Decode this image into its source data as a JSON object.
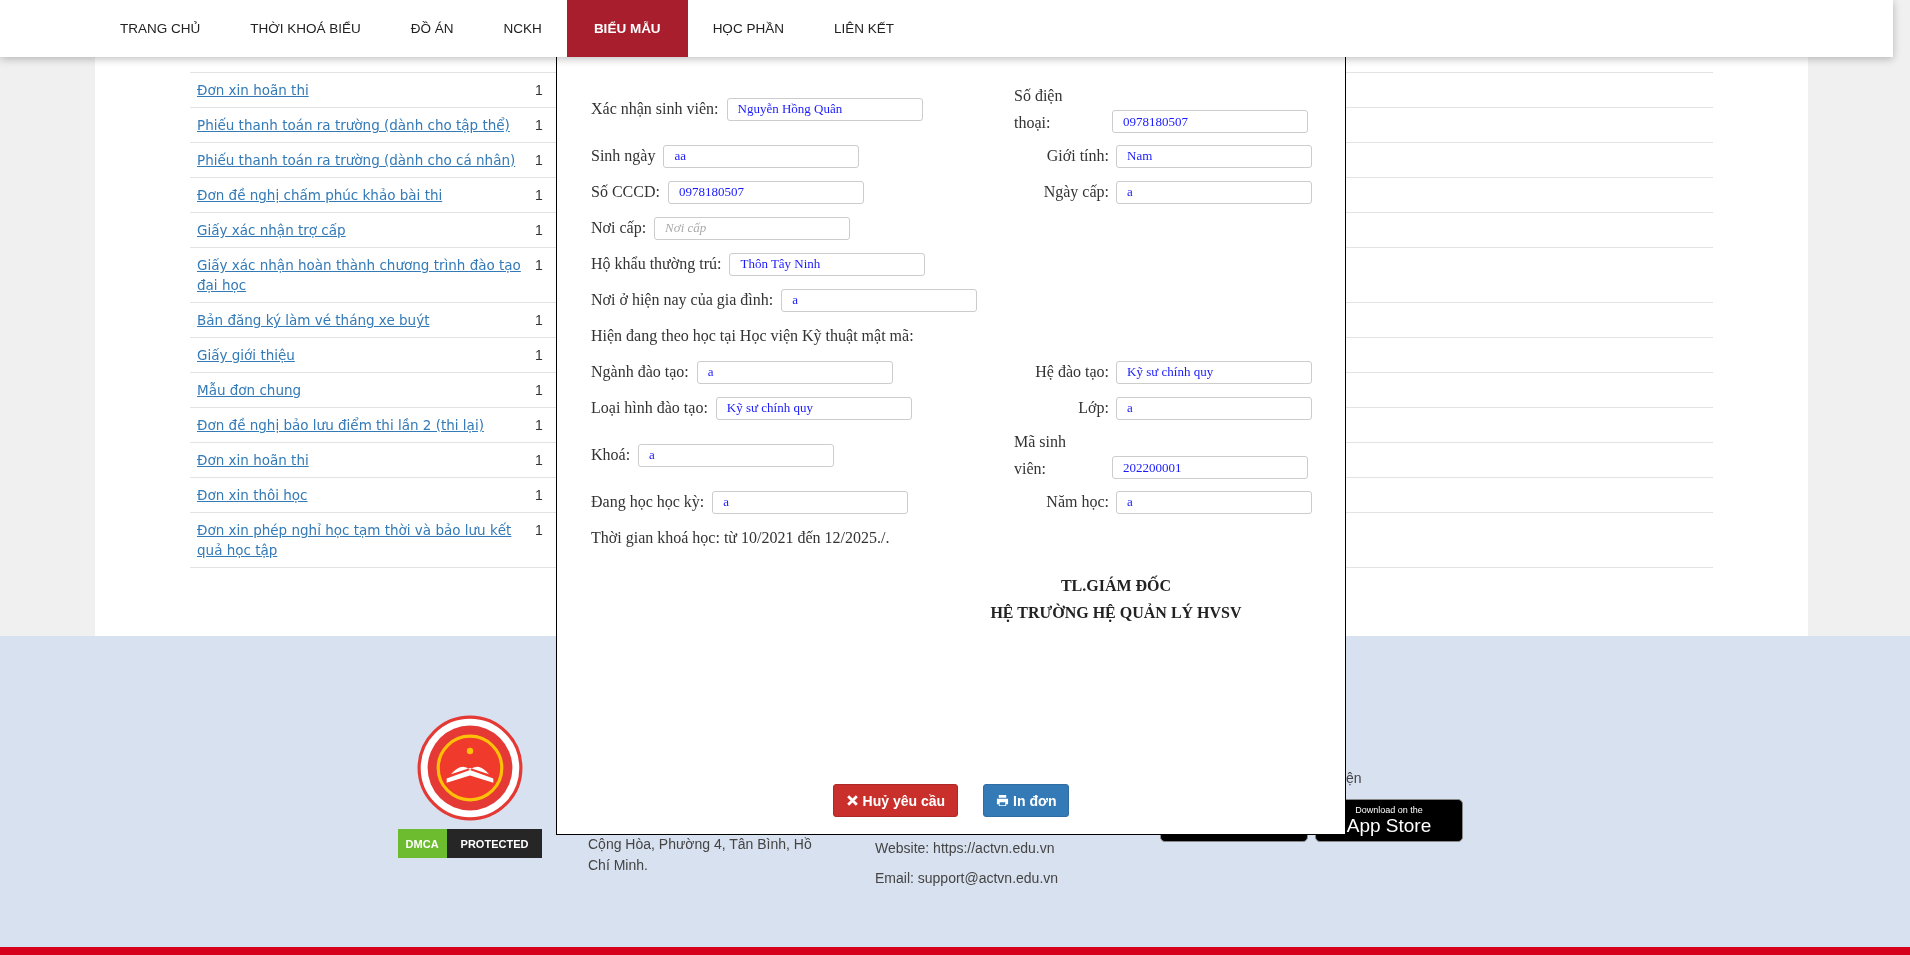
{
  "nav": {
    "items": [
      {
        "label": "TRANG CHỦ",
        "selected": false
      },
      {
        "label": "THỜI KHOÁ BIỂU",
        "selected": false
      },
      {
        "label": "ĐỒ ÁN",
        "selected": false
      },
      {
        "label": "NCKH",
        "selected": false
      },
      {
        "label": "BIỂU MẪU",
        "selected": true
      },
      {
        "label": "HỌC PHẦN",
        "selected": false
      },
      {
        "label": "LIÊN KẾT",
        "selected": false
      }
    ]
  },
  "forms_table": {
    "rows": [
      {
        "name": "Đơn xin hoãn thi",
        "count": "1"
      },
      {
        "name": "Phiếu thanh toán ra trường (dành cho tập thể)",
        "count": "1"
      },
      {
        "name": "Phiếu thanh toán ra trường (dành cho cá nhân)",
        "count": "1"
      },
      {
        "name": "Đơn đề nghị chấm phúc khảo bài thi",
        "count": "1"
      },
      {
        "name": "Giấy xác nhận trợ cấp",
        "count": "1"
      },
      {
        "name": "Giấy xác nhận hoàn thành chương trình đào tạo đại học",
        "count": "1"
      },
      {
        "name": "Bản đăng ký làm vé tháng xe buýt",
        "count": "1"
      },
      {
        "name": "Giấy giới thiệu",
        "count": "1"
      },
      {
        "name": "Mẫu đơn chung",
        "count": "1"
      },
      {
        "name": "Đơn đề nghị bảo lưu điểm thi lần 2 (thi lại)",
        "count": "1"
      },
      {
        "name": "Đơn xin hoãn thi",
        "count": "1"
      },
      {
        "name": "Đơn xin thôi học",
        "count": "1"
      },
      {
        "name": "Đơn xin phép nghỉ học tạm thời và bảo lưu kết quả học tập",
        "count": "1"
      }
    ]
  },
  "dialog": {
    "rows": [
      {
        "kind": "pair",
        "left": {
          "label": "Xác nhận sinh viên:",
          "value": "Nguyễn Hồng Quân"
        },
        "right": {
          "label": "Số điện thoại:",
          "value": "0978180507",
          "kind": "stacked"
        }
      },
      {
        "kind": "pair",
        "left": {
          "label": "Sinh ngày",
          "value": "aa"
        },
        "right": {
          "label": "Giới tính:",
          "value": "Nam",
          "kind": "inline"
        }
      },
      {
        "kind": "pair",
        "left": {
          "label": "Số CCCD:",
          "value": "0978180507"
        },
        "right": {
          "label": "Ngày cấp:",
          "value": "a",
          "kind": "inline"
        }
      },
      {
        "kind": "pair",
        "left": {
          "label": "Nơi cấp:",
          "placeholder": "Nơi cấp"
        }
      },
      {
        "kind": "pair",
        "left": {
          "label": "Hộ khẩu thường trú:",
          "value": "Thôn Tây Ninh"
        }
      },
      {
        "kind": "pair",
        "left": {
          "label": "Nơi ở hiện nay của gia đình:",
          "value": "a"
        }
      },
      {
        "kind": "note",
        "text": "Hiện đang theo học tại Học viện Kỹ thuật mật mã:"
      },
      {
        "kind": "pair",
        "left": {
          "label": "Ngành đào tạo:",
          "value": "a"
        },
        "right": {
          "label": "Hệ đào tạo:",
          "value": "Kỹ sư chính quy",
          "kind": "inline"
        }
      },
      {
        "kind": "pair",
        "left": {
          "label": "Loại hình đào tạo:",
          "value": "Kỹ sư chính quy"
        },
        "right": {
          "label": "Lớp:",
          "value": "a",
          "kind": "inline"
        }
      },
      {
        "kind": "pair",
        "left": {
          "label": "Khoá:",
          "value": "a"
        },
        "right": {
          "label": "Mã sinh viên:",
          "value": "202200001",
          "kind": "stacked"
        }
      },
      {
        "kind": "pair",
        "left": {
          "label": "Đang học học kỳ:",
          "value": "a"
        },
        "right": {
          "label": "Năm học:",
          "value": "a",
          "kind": "inline"
        }
      },
      {
        "kind": "note",
        "text": "Thời gian khoá học: từ 10/2021 đến 12/2025./."
      }
    ],
    "signature": [
      "TL.GIÁM ĐỐC",
      "HỆ TRƯỜNG HỆ QUẢN LÝ HVSV"
    ],
    "buttons": [
      {
        "label": "Huỷ yêu cầu",
        "kind": "cancel"
      },
      {
        "label": "In đơn",
        "kind": "print"
      }
    ]
  },
  "footer": {
    "badge": {
      "left": "DMCA",
      "right": "PROTECTED"
    },
    "address": "Cộng Hòa, Phường 4, Tân Bình, Hồ Chí Minh.",
    "website": "Website: https://actvn.edu.vn",
    "email": "Email: support@actvn.edu.vn",
    "apps_heading": "ện",
    "app_store": {
      "small": "Download on the",
      "large": "App Store"
    }
  }
}
